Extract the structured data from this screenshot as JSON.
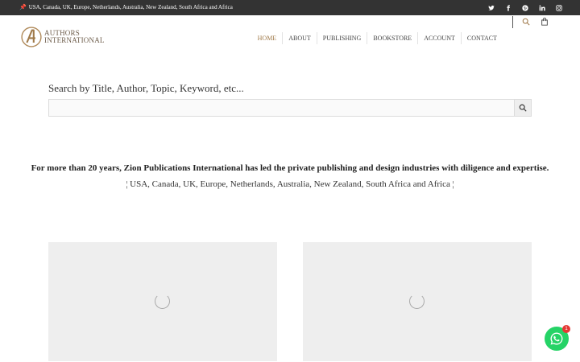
{
  "topbar": {
    "locations": "USA, Canada, UK, Europe, Netherlands, Australia, New Zealand, South Africa and Africa",
    "pin_icon": "pin-icon",
    "social": [
      "twitter-icon",
      "facebook-icon",
      "pinterest-icon",
      "linkedin-icon",
      "instagram-icon"
    ]
  },
  "logo": {
    "line1": "AUTHORS",
    "line2": "INTERNATIONAL",
    "color": "#6d5c4a"
  },
  "nav": {
    "items": [
      "HOME",
      "ABOUT",
      "PUBLISHING",
      "BOOKSTORE",
      "ACCOUNT",
      "CONTACT"
    ],
    "active_index": 0,
    "active_color": "#a07a4a"
  },
  "header_icons": [
    "search-icon",
    "shopping-bag-icon"
  ],
  "search": {
    "label": "Search by Title, Author, Topic, Keyword, etc...",
    "value": "",
    "placeholder": ""
  },
  "intro": {
    "tagline": "For more than 20 years, Zion Publications International has led the private publishing and design industries with diligence and expertise.",
    "regions": "¦ USA, Canada, UK, Europe, Netherlands, Australia, New Zealand, South Africa and Africa ¦"
  },
  "chat": {
    "badge_count": "1",
    "color": "#25d366"
  }
}
